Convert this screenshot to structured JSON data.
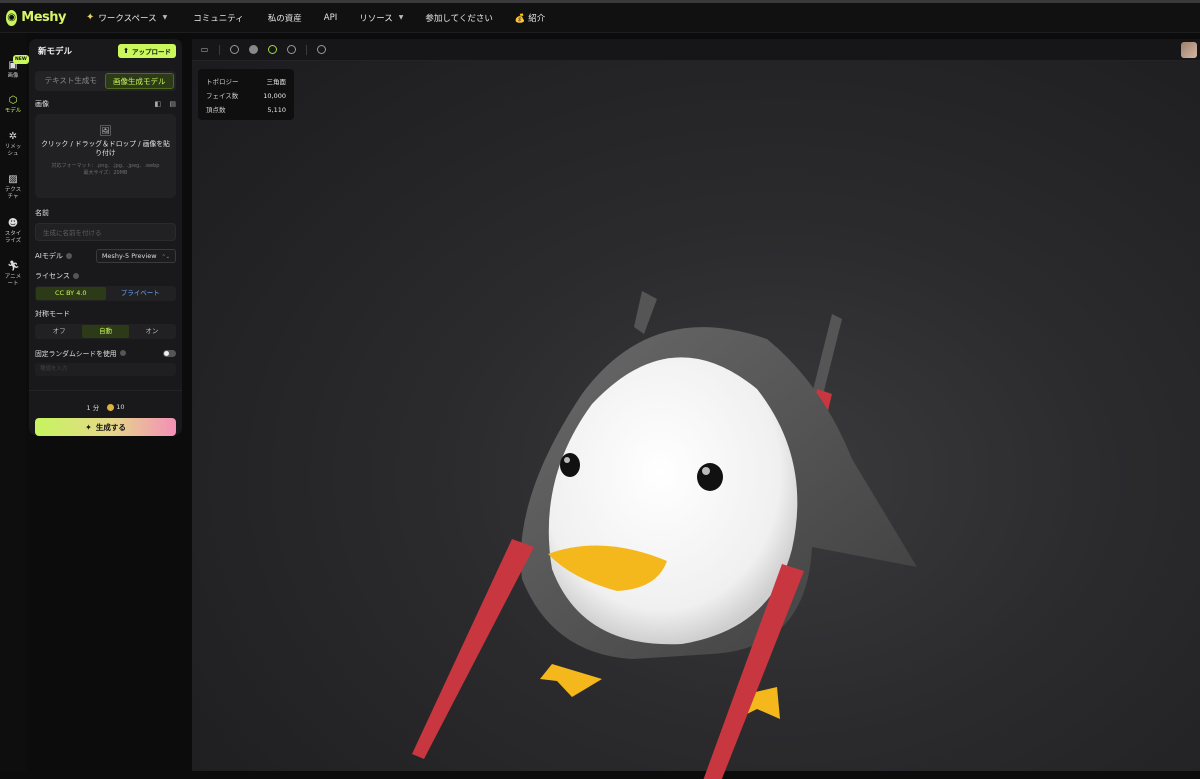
{
  "brand": {
    "name": "Meshy"
  },
  "nav": {
    "workspace": "ワークスペース",
    "community": "コミュニティ",
    "assets": "私の資産",
    "api": "API",
    "resources": "リソース",
    "join": "参加してください",
    "referral": "💰 紹介"
  },
  "rail": {
    "new_badge": "NEW",
    "image": "画像",
    "model": "モデル",
    "remesh": "リメッシュ",
    "texture": "テクスチャ",
    "stylize": "スタイライズ",
    "animate": "アニメート"
  },
  "panel": {
    "title": "新モデル",
    "upload": "アップロード",
    "tab_text": "テキスト生成モ",
    "tab_image": "画像生成モデル",
    "image_label": "画像",
    "drop_main": "クリック / ドラッグ＆ドロップ / 画像を貼り付け",
    "drop_formats": "対応フォーマット：.png、.jpg、.jpeg、.webp",
    "drop_size": "最大サイズ：20MB",
    "name_label": "名前",
    "name_placeholder": "生成に名前を付ける",
    "ai_label": "AIモデル",
    "ai_value": "Meshy-5 Preview",
    "license_label": "ライセンス",
    "license_cc": "CC BY 4.0",
    "license_private": "プライベート",
    "sym_label": "対称モード",
    "sym_off": "オフ",
    "sym_auto": "自動",
    "sym_on": "オン",
    "seed_label": "固定ランダムシードを使用",
    "seed_placeholder": "種値を入力",
    "time": "1 分",
    "credits": "10",
    "generate": "生成する"
  },
  "stats": {
    "topology_label": "トポロジー",
    "topology_value": "三角面",
    "faces_label": "フェイス数",
    "faces_value": "10,000",
    "verts_label": "頂点数",
    "verts_value": "5,110"
  },
  "colors": {
    "accent": "#c9f75c",
    "link": "#6da7ff"
  }
}
